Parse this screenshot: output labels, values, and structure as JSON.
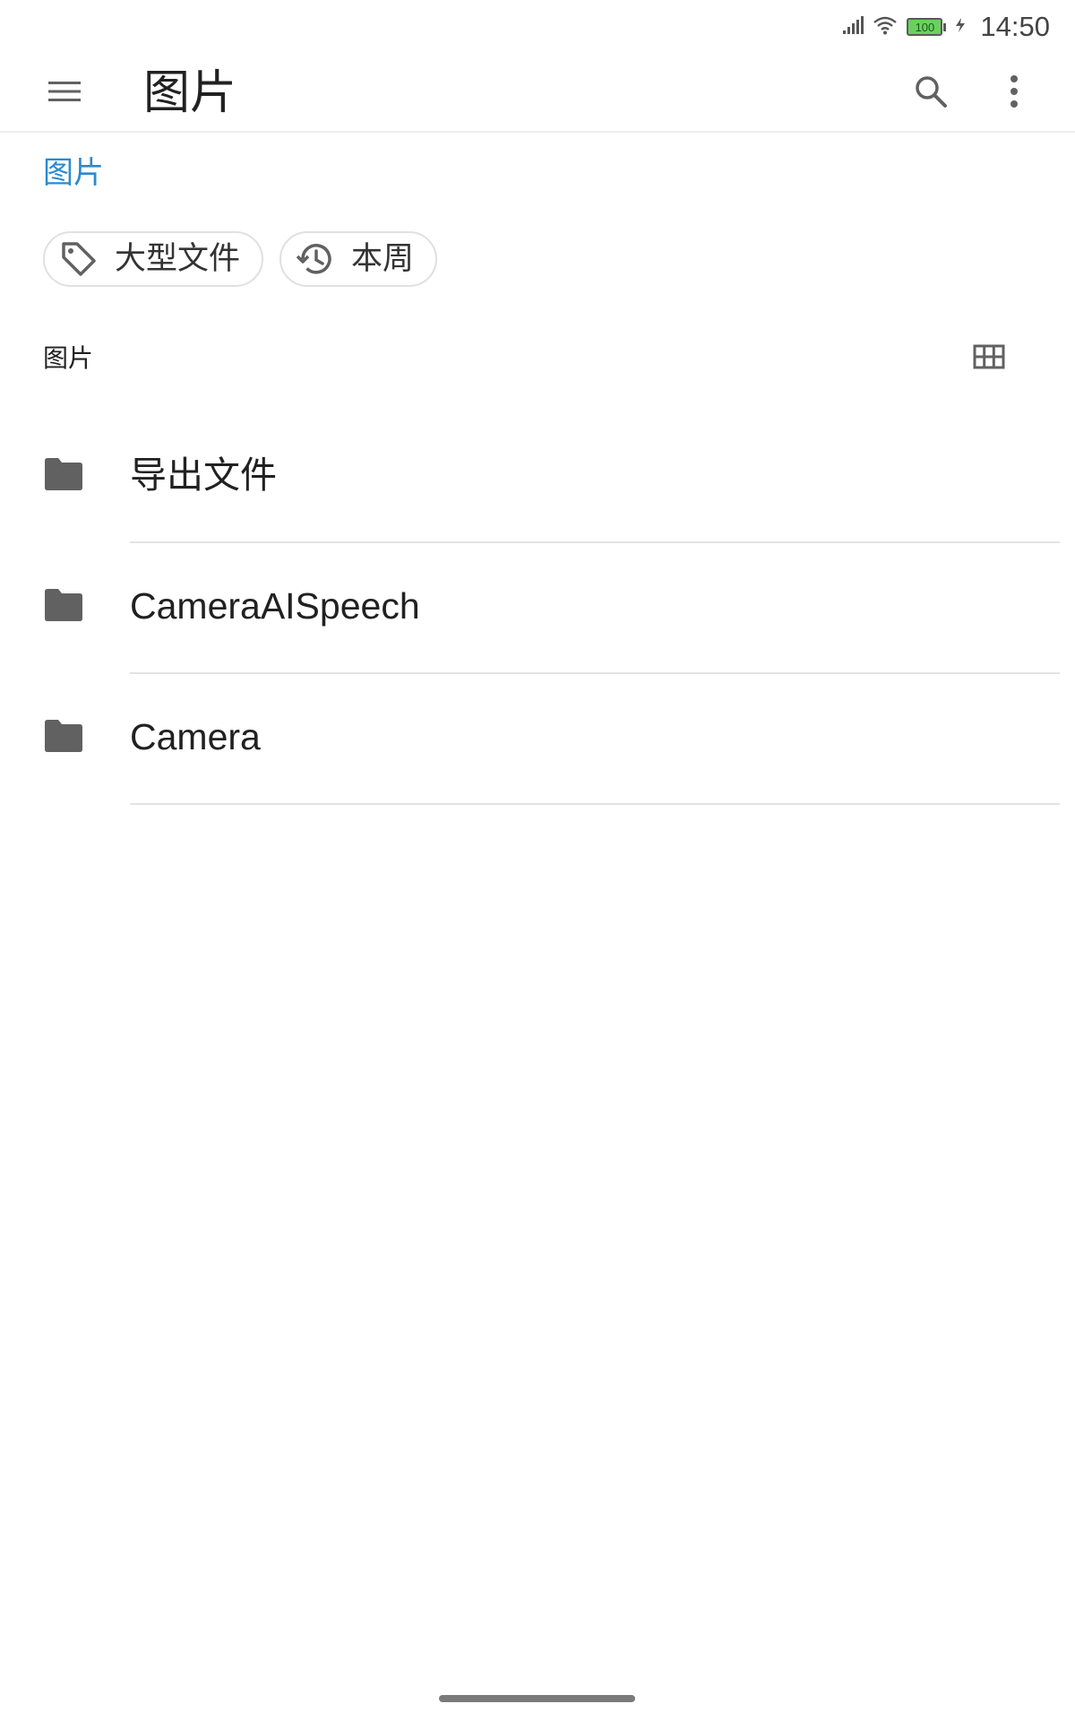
{
  "status_bar": {
    "time": "14:50",
    "battery_level": "100",
    "icons": [
      "signal-icon",
      "wifi-icon",
      "battery-icon",
      "charging-icon"
    ]
  },
  "app_bar": {
    "title": "图片",
    "icons": {
      "menu": "menu-icon",
      "search": "search-icon",
      "more": "more-vert-icon"
    }
  },
  "breadcrumb": {
    "label": "图片"
  },
  "chips": [
    {
      "label": "大型文件",
      "icon": "tag-icon"
    },
    {
      "label": "本周",
      "icon": "history-icon"
    }
  ],
  "section": {
    "title": "图片",
    "view_toggle_icon": "grid-view-icon"
  },
  "folders": [
    {
      "name": "导出文件",
      "icon": "folder-icon"
    },
    {
      "name": "CameraAISpeech",
      "icon": "folder-icon"
    },
    {
      "name": "Camera",
      "icon": "folder-icon"
    }
  ],
  "colors": {
    "accent": "#2b8ad0",
    "icon_gray": "#616161",
    "divider": "#e3e3e3"
  }
}
